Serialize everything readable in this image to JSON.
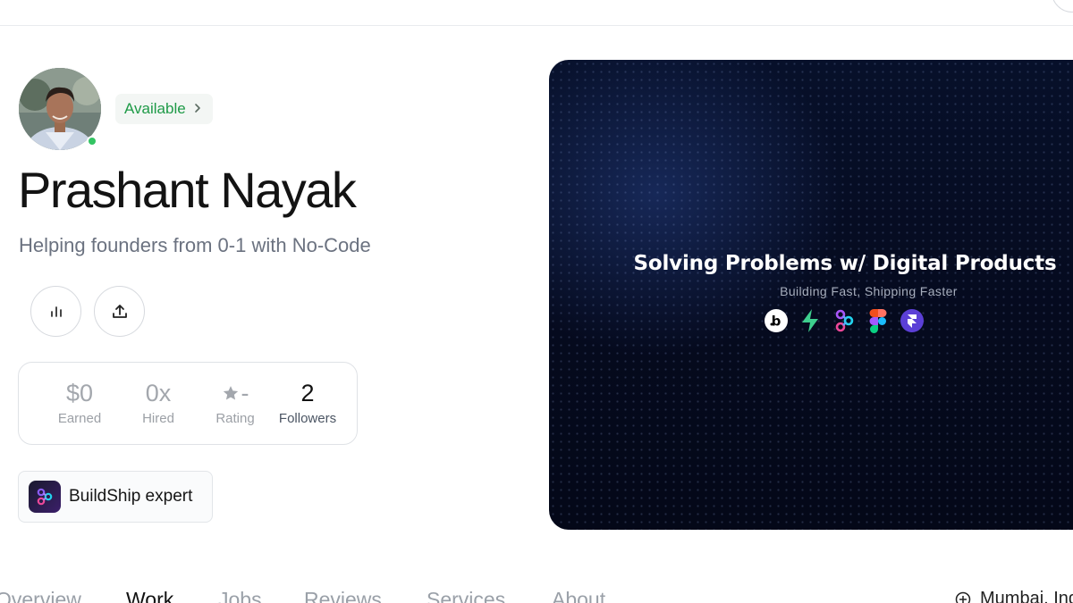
{
  "profile": {
    "name": "Prashant Nayak",
    "tagline": "Helping founders from 0-1 with No-Code",
    "availability": "Available",
    "online": true
  },
  "actions": [
    {
      "icon": "bar-chart-icon"
    },
    {
      "icon": "share-upload-icon"
    }
  ],
  "stats": {
    "earned": {
      "value": "$0",
      "label": "Earned"
    },
    "hired": {
      "value": "0x",
      "label": "Hired"
    },
    "rating": {
      "value": "-",
      "label": "Rating"
    },
    "followers": {
      "value": "2",
      "label": "Followers"
    }
  },
  "expert_badge": {
    "label": "BuildShip expert",
    "icon": "buildship-logo-icon"
  },
  "banner": {
    "title": "Solving Problems w/ Digital Products",
    "subtitle": "Building Fast, Shipping Faster",
    "icons": [
      "bubble-logo-icon",
      "supabase-logo-icon",
      "buildship-logo-icon",
      "figma-logo-icon",
      "framer-logo-icon"
    ]
  },
  "tabs": [
    "Overview",
    "Work",
    "Jobs",
    "Reviews",
    "Services",
    "About"
  ],
  "active_tab": "Work",
  "location": "Mumbai, Ind",
  "colors": {
    "available_green": "#1e9a47",
    "online_dot": "#33c463",
    "banner_bg": "#050a1e"
  }
}
